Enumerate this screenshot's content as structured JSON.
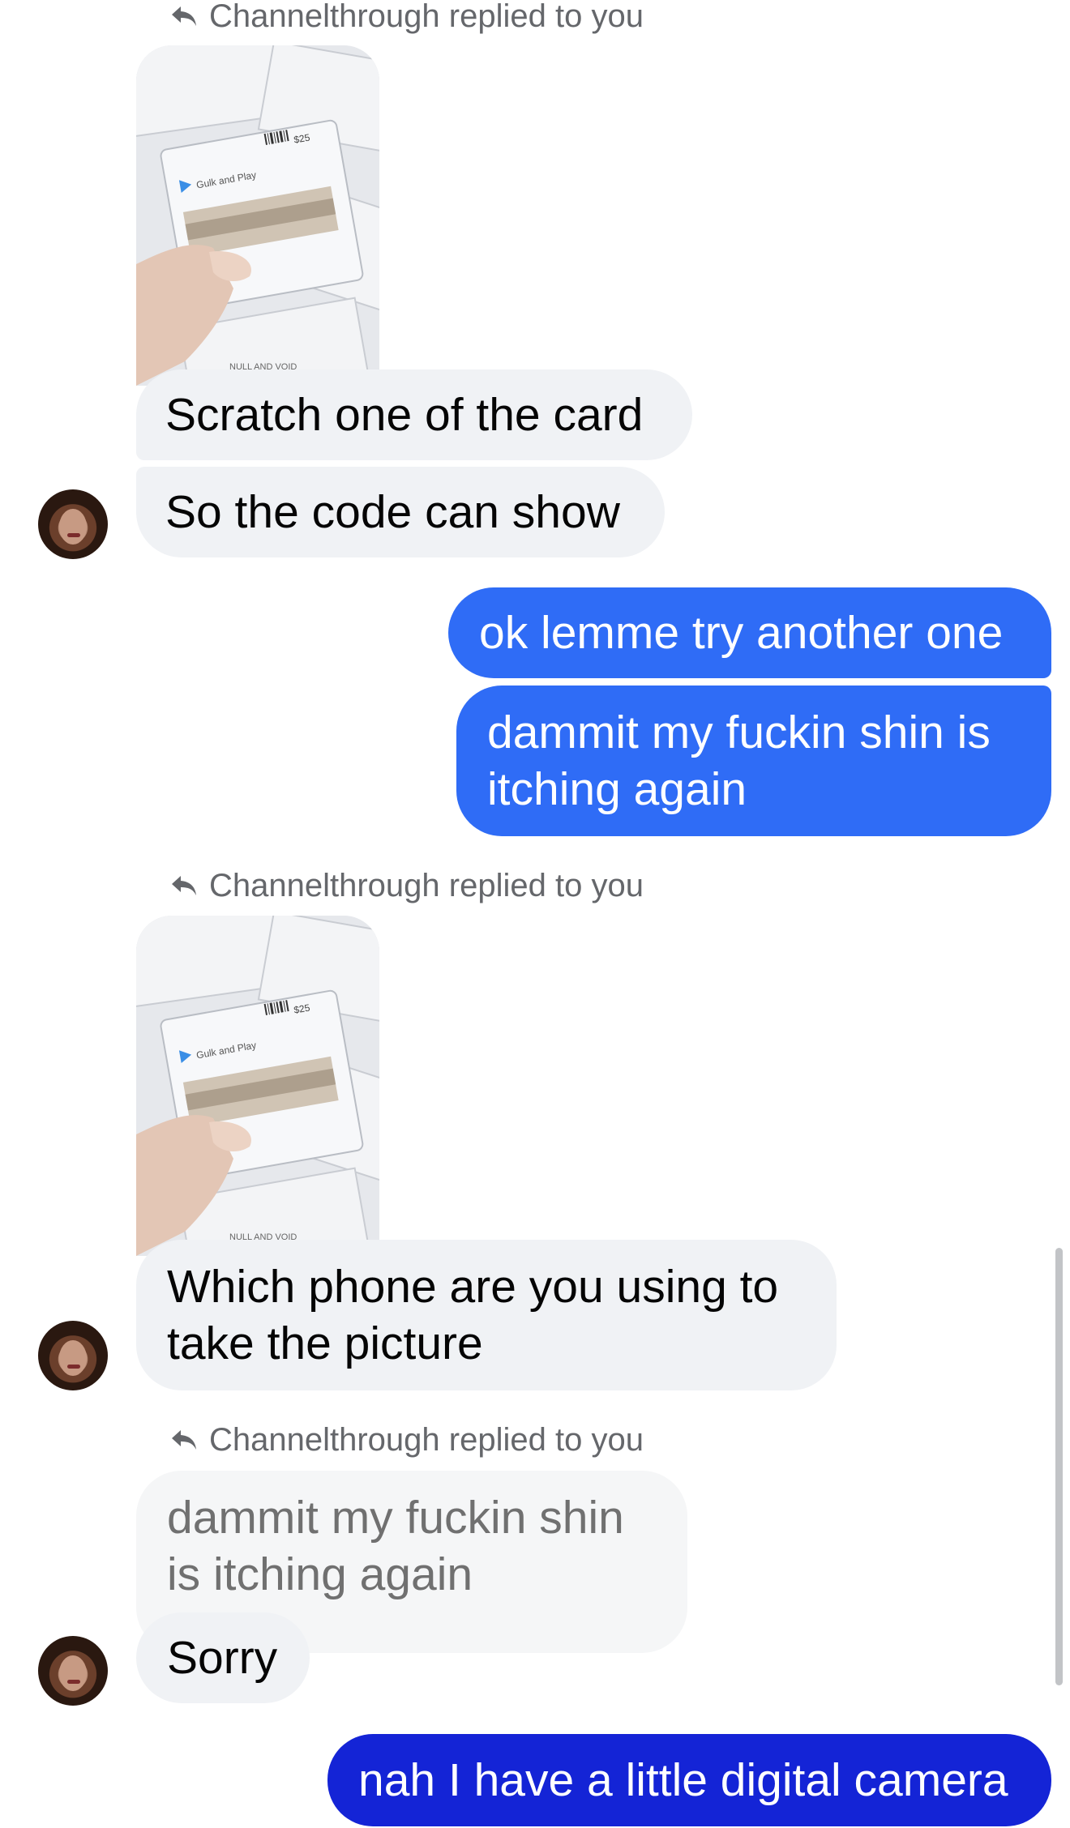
{
  "replies": {
    "label_1": "Channelthrough replied to you",
    "label_2": "Channelthrough replied to you",
    "label_3": "Channelthrough replied to you"
  },
  "thumbnail": {
    "brand": "Gulk and Play",
    "price": "$25",
    "stamp": "NULL AND VOID"
  },
  "messages": {
    "m1": "Scratch one of the card",
    "m2": "So the code can show",
    "m3": "ok lemme try another one",
    "m4": "dammit my fuckin shin is itching again",
    "m5": "Which phone are you using to take the picture",
    "quoted": "dammit my fuckin shin is itching again",
    "m6": "Sorry",
    "m7": "nah I have a little digital camera"
  },
  "colors": {
    "outgoing_blue": "#2f6cf6",
    "outgoing_dark_blue": "#1424d6",
    "incoming_gray": "#f0f2f5"
  },
  "icons": {
    "reply": "reply-arrow-icon",
    "avatar": "contact-avatar"
  }
}
